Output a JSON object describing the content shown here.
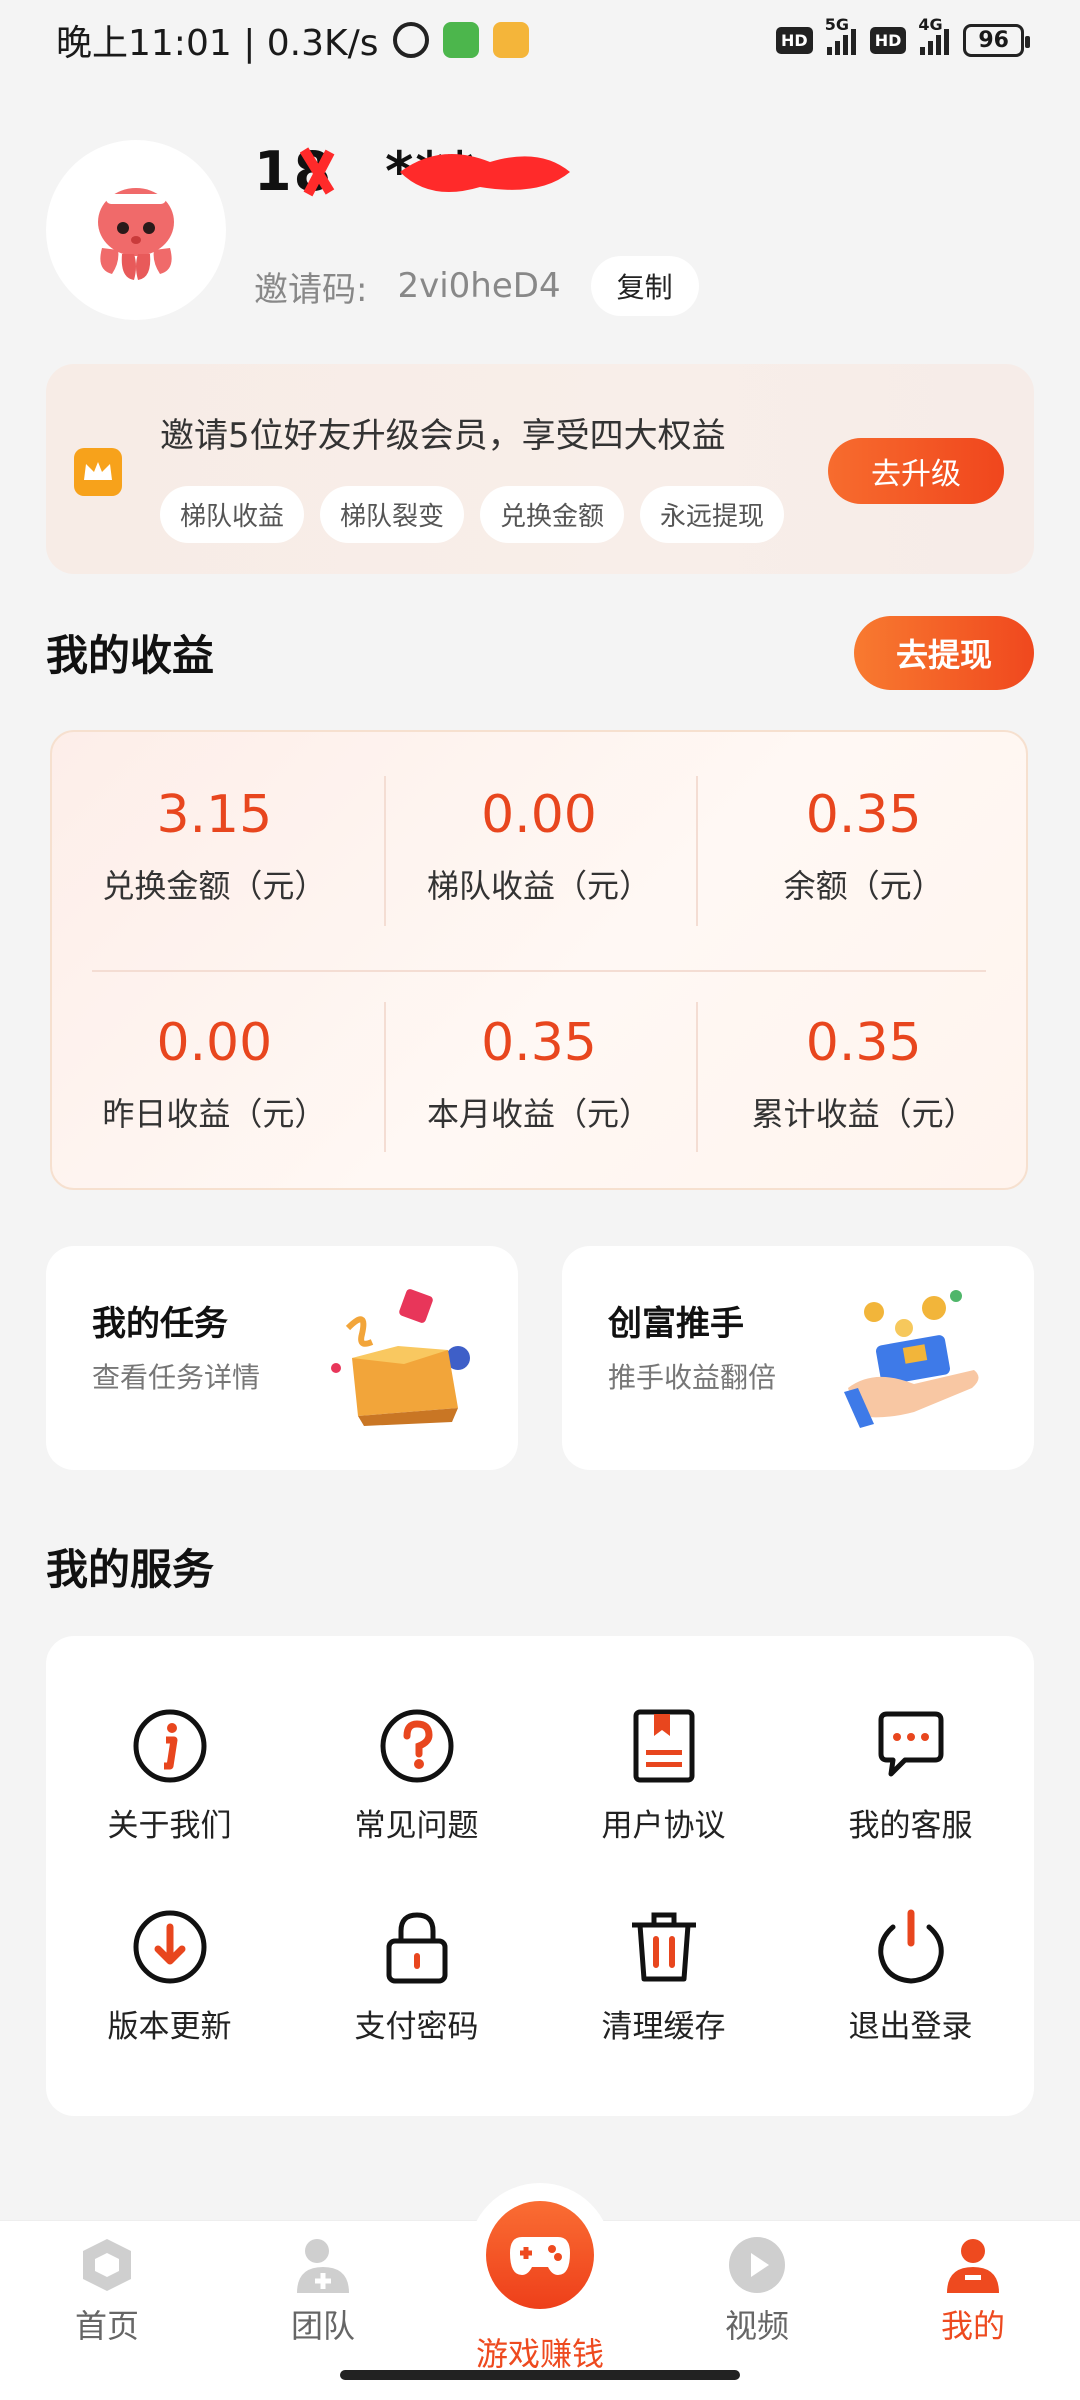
{
  "status_bar": {
    "time_speed": "晚上11:01 | 0.3K/s",
    "net1": "5G",
    "net2": "4G",
    "battery": "96",
    "hd": "HD"
  },
  "profile": {
    "phone": "18",
    "phone_masked": "***",
    "invite_label": "邀请码:",
    "invite_code": "2vi0heD4",
    "copy_label": "复制"
  },
  "upgrade": {
    "title": "邀请5位好友升级会员，享受四大权益",
    "tags": [
      "梯队收益",
      "梯队裂变",
      "兑换金额",
      "永远提现"
    ],
    "button": "去升级"
  },
  "earnings": {
    "title": "我的收益",
    "withdraw": "去提现",
    "items": [
      {
        "value": "3.15",
        "label": "兑换金额（元）"
      },
      {
        "value": "0.00",
        "label": "梯队收益（元）"
      },
      {
        "value": "0.35",
        "label": "余额（元）"
      },
      {
        "value": "0.00",
        "label": "昨日收益（元）"
      },
      {
        "value": "0.35",
        "label": "本月收益（元）"
      },
      {
        "value": "0.35",
        "label": "累计收益（元）"
      }
    ]
  },
  "cards": {
    "tasks": {
      "title": "我的任务",
      "sub": "查看任务详情"
    },
    "boost": {
      "title": "创富推手",
      "sub": "推手收益翻倍"
    }
  },
  "services": {
    "title": "我的服务",
    "items": [
      {
        "label": "关于我们",
        "icon": "info-icon"
      },
      {
        "label": "常见问题",
        "icon": "question-icon"
      },
      {
        "label": "用户协议",
        "icon": "document-icon"
      },
      {
        "label": "我的客服",
        "icon": "chat-icon"
      },
      {
        "label": "版本更新",
        "icon": "download-icon"
      },
      {
        "label": "支付密码",
        "icon": "lock-icon"
      },
      {
        "label": "清理缓存",
        "icon": "trash-icon"
      },
      {
        "label": "退出登录",
        "icon": "power-icon"
      }
    ]
  },
  "nav": {
    "home": "首页",
    "team": "团队",
    "game": "游戏赚钱",
    "video": "视频",
    "mine": "我的"
  },
  "colors": {
    "accent": "#ee4a1f",
    "icon_red": "#e8461e"
  }
}
